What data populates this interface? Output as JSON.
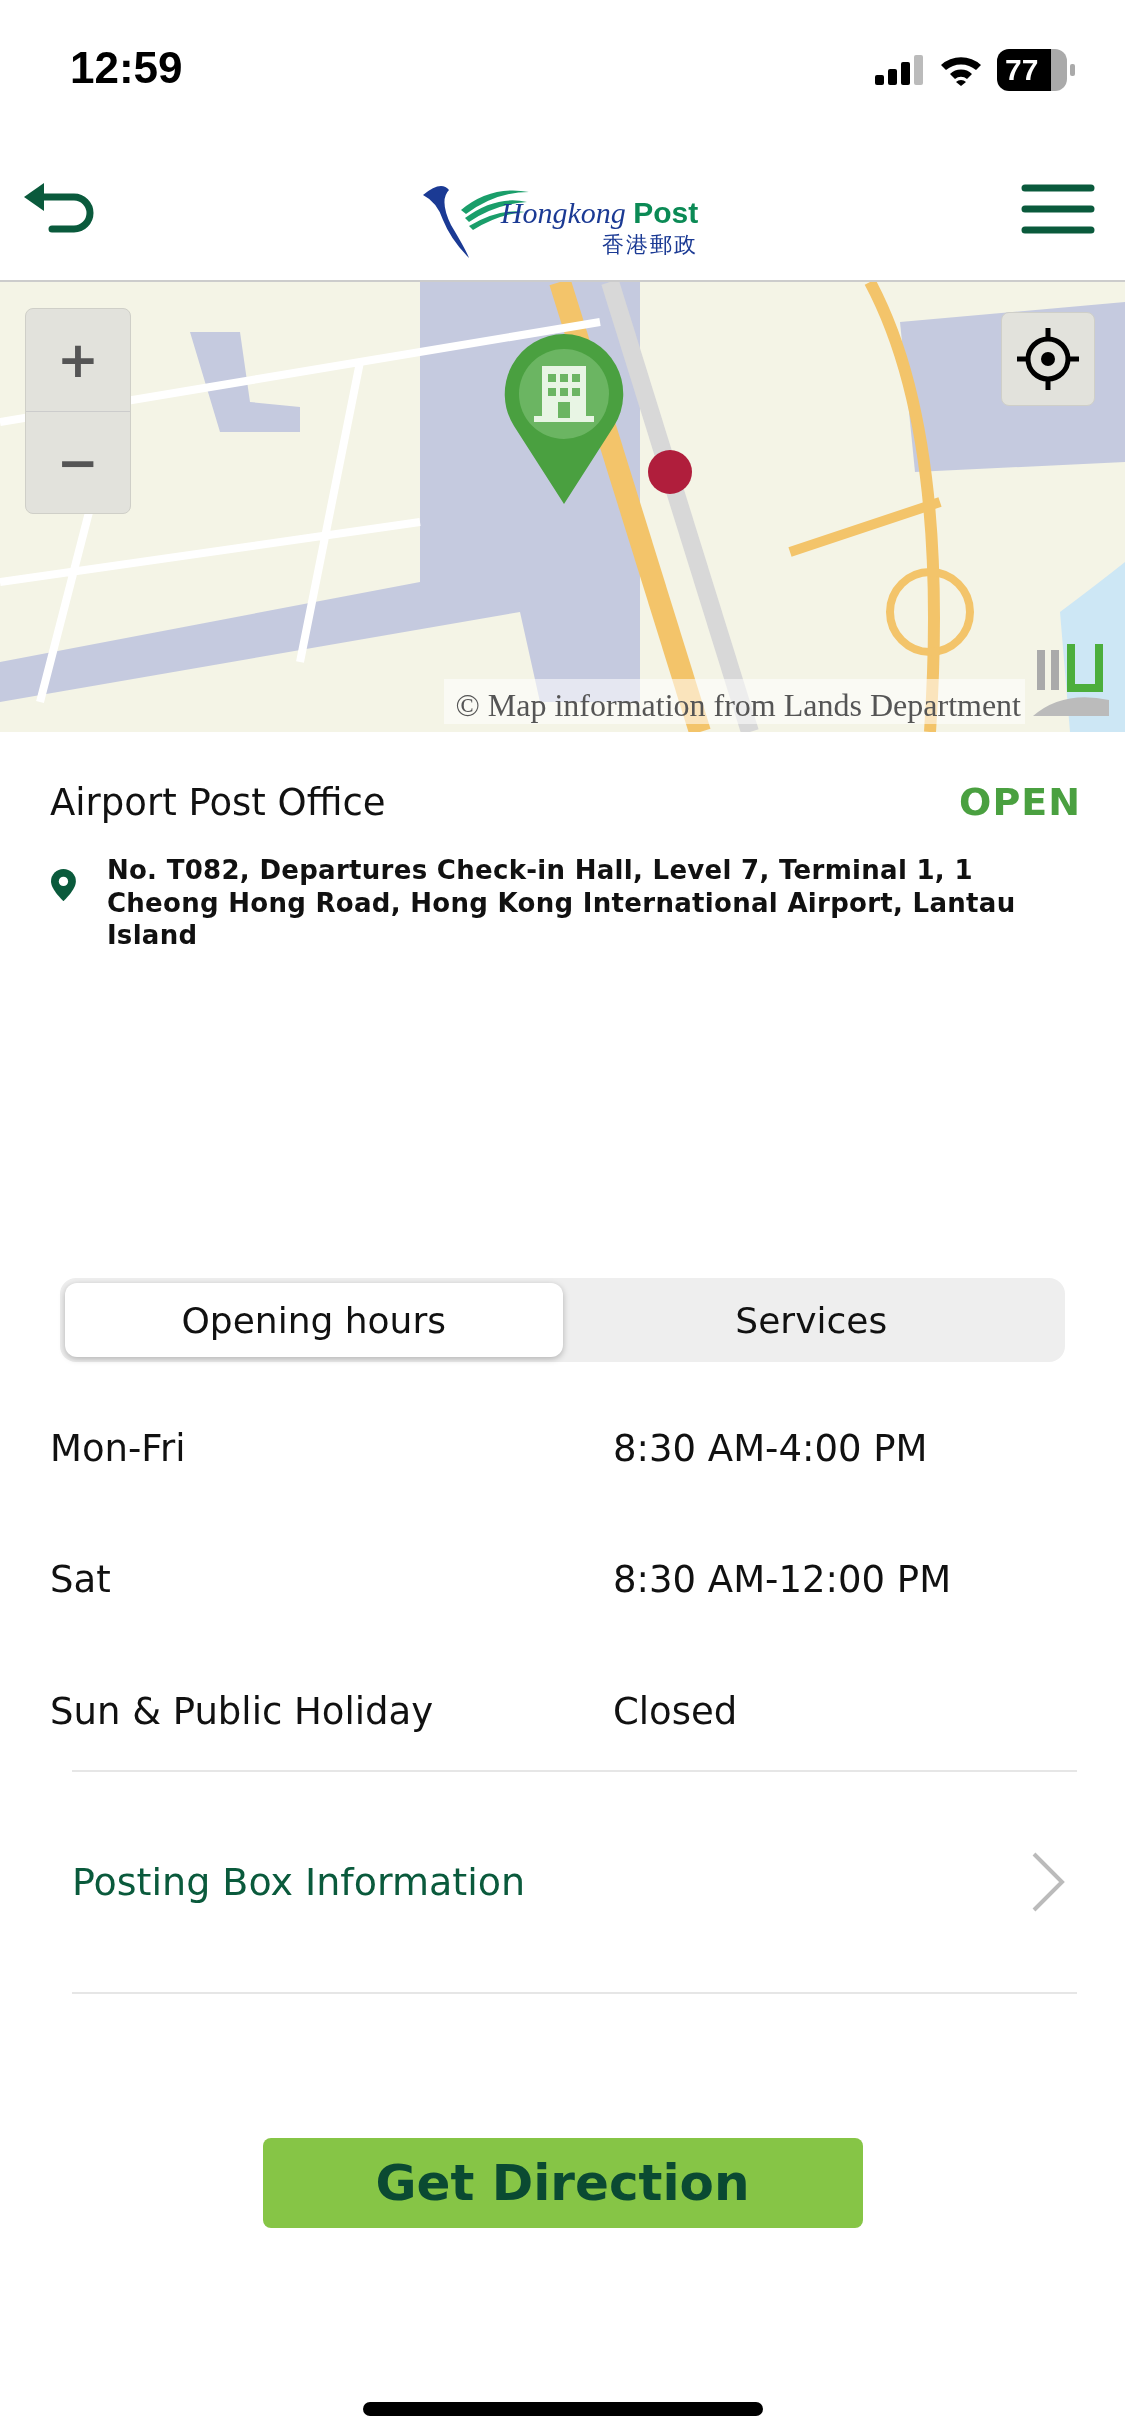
{
  "status_bar": {
    "time": "12:59",
    "battery": "77"
  },
  "header": {
    "logo_name": "Hongkong",
    "logo_brand": "Post",
    "logo_chinese": "香港郵政"
  },
  "map": {
    "zoom_in": "+",
    "zoom_out": "−",
    "attribution": "© Map information from Lands Department"
  },
  "office": {
    "name": "Airport Post Office",
    "status": "OPEN",
    "address": "No. T082, Departures Check-in Hall, Level 7, Terminal 1, 1 Cheong Hong Road, Hong Kong International Airport, Lantau Island"
  },
  "tabs": [
    {
      "label": "Opening hours",
      "selected": true
    },
    {
      "label": "Services",
      "selected": false
    }
  ],
  "hours": [
    {
      "day": "Mon-Fri",
      "time": "8:30 AM-4:00 PM"
    },
    {
      "day": "Sat",
      "time": "8:30 AM-12:00 PM"
    },
    {
      "day": "Sun & Public Holiday",
      "time": "Closed"
    }
  ],
  "posting_box": {
    "label": "Posting Box Information"
  },
  "direction_button": {
    "label": "Get Direction"
  }
}
